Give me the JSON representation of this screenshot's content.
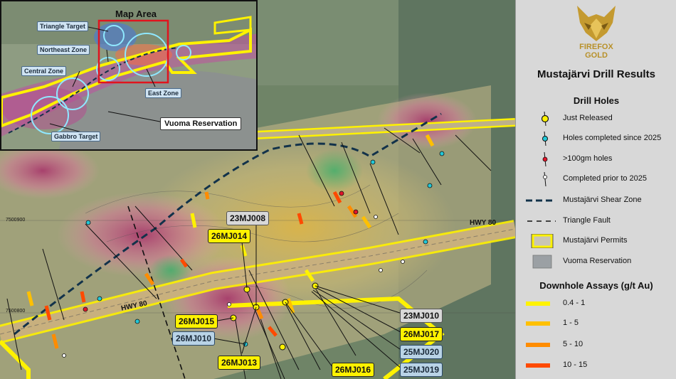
{
  "inset": {
    "title": "Map Area",
    "labels": {
      "triangle": "Triangle Target",
      "northeast": "Northeast Zone",
      "central": "Central Zone",
      "east": "East Zone",
      "gabbro": "Gabbro Target",
      "vuoma": "Vuoma Reservation"
    }
  },
  "map": {
    "highway_label_1": "HWY 80",
    "highway_label_2": "HWY 80",
    "northing_1": "7500900",
    "northing_2": "7500800",
    "callouts": {
      "c23MJ008": "23MJ008",
      "c26MJ014": "26MJ014",
      "c26MJ015": "26MJ015",
      "c26MJ010": "26MJ010",
      "c26MJ013": "26MJ013",
      "c26MJ016": "26MJ016",
      "c23MJ010": "23MJ010",
      "c26MJ017": "26MJ017",
      "c25MJ020": "25MJ020",
      "c25MJ019": "25MJ019"
    }
  },
  "legend": {
    "logo_line1": "FIREFOX",
    "logo_line2": "GOLD",
    "title": "Mustajärvi Drill Results",
    "drill_heading": "Drill Holes",
    "items": {
      "just_released": "Just Released",
      "since_2025": "Holes completed since 2025",
      "over_100gm": ">100gm holes",
      "prior_2025": "Completed prior to 2025",
      "shear_zone": "Mustajärvi Shear Zone",
      "triangle_fault": "Triangle Fault",
      "permits": "Mustajärvi Permits",
      "vuoma": "Vuoma Reservation"
    },
    "assay_heading": "Downhole Assays (g/t Au)",
    "assays": [
      "0.4 - 1",
      "1 - 5",
      "5 - 10",
      "10 - 15"
    ],
    "colors": {
      "assay_1": "#fff200",
      "assay_2": "#ffc000",
      "assay_3": "#ff8c00",
      "assay_4": "#ff4a00",
      "permit_outline": "#fff200",
      "reservation": "#9ba0a4",
      "just_released_fill": "#fff200",
      "since_2025_fill": "#22c8d8",
      "over_100_fill": "#e0162a"
    }
  }
}
